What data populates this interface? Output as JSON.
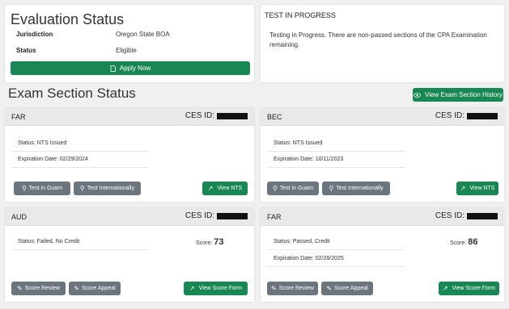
{
  "evaluation": {
    "title": "Evaluation Status",
    "jurisdiction_label": "Jurisdiction",
    "jurisdiction_value": "Oregon State BOA",
    "status_label": "Status",
    "status_value": "Eligible",
    "apply_label": "Apply Now"
  },
  "test_in_progress": {
    "title": "TEST IN PROGRESS",
    "body": "Testing in Progress. There are non-passed sections of the CPA Examination remaining."
  },
  "exam_section": {
    "title": "Exam Section Status",
    "history_label": "View Exam Section History"
  },
  "ces_label": "CES ID:",
  "cards": [
    {
      "name": "FAR",
      "status": "Status: NTS Issued",
      "expiration": "Expiration Date: 02/29/2024",
      "btn_a": "Test in Guam",
      "btn_b": "Test Internationally",
      "btn_c": "View NTS"
    },
    {
      "name": "BEC",
      "status": "Status: NTS Issued",
      "expiration": "Expiration Date: 10/11/2023",
      "btn_a": "Test in Guam",
      "btn_b": "Test Internationally",
      "btn_c": "View NTS"
    },
    {
      "name": "AUD",
      "status": "Status: Failed, No Credit",
      "score_label": "Score:",
      "score": "73",
      "btn_a": "Score Review",
      "btn_b": "Score Appeal",
      "btn_c": "View Score Form"
    },
    {
      "name": "FAR",
      "status": "Status: Passed, Credit",
      "expiration": "Expiration Date: 02/28/2025",
      "score_label": "Score:",
      "score": "86",
      "btn_a": "Score Review",
      "btn_b": "Score Appeal",
      "btn_c": "View Score Form"
    }
  ],
  "colors": {
    "green": "#198754",
    "gray": "#6c757d",
    "header": "#e9e9e9"
  }
}
